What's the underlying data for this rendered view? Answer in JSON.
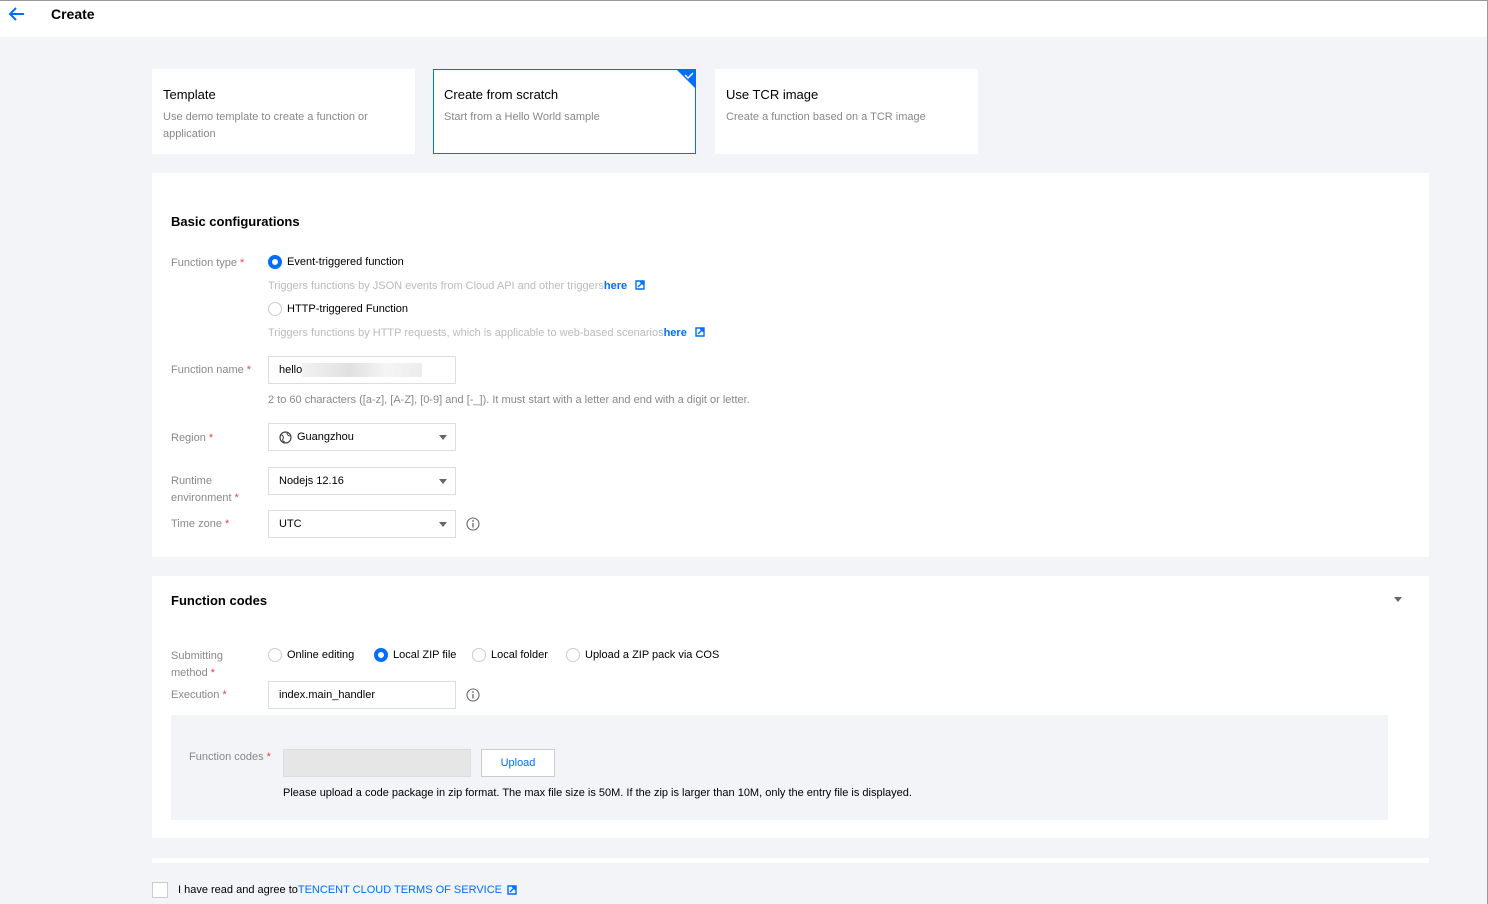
{
  "header": {
    "title": "Create"
  },
  "modes": [
    {
      "title": "Template",
      "desc": "Use demo template to create a function or application"
    },
    {
      "title": "Create from scratch",
      "desc": "Start from a Hello World sample"
    },
    {
      "title": "Use TCR image",
      "desc": "Create a function based on a TCR image"
    }
  ],
  "basic": {
    "title": "Basic configurations",
    "function_type_label": "Function type",
    "event_option": "Event-triggered function",
    "event_hint": "Triggers functions by JSON events from Cloud API and other triggers",
    "event_link": "here",
    "http_option": "HTTP-triggered Function",
    "http_hint": "Triggers functions by HTTP requests, which is applicable to web-based scenarios",
    "http_link": "here",
    "function_name_label": "Function name",
    "function_name_value": "hello",
    "function_name_help": "2 to 60 characters ([a-z], [A-Z], [0-9] and [-_]). It must start with a letter and end with a digit or letter.",
    "region_label": "Region",
    "region_value": "Guangzhou",
    "runtime_label_1": "Runtime",
    "runtime_label_2": "environment",
    "runtime_value": "Nodejs 12.16",
    "timezone_label": "Time zone",
    "timezone_value": "UTC"
  },
  "codes": {
    "title": "Function codes",
    "submit_label_1": "Submitting",
    "submit_label_2": "method",
    "methods": [
      "Online editing",
      "Local ZIP file",
      "Local folder",
      "Upload a ZIP pack via COS"
    ],
    "execution_label": "Execution",
    "execution_value": "index.main_handler",
    "function_codes_label": "Function codes",
    "upload_label": "Upload",
    "upload_note": "Please upload a code package in zip format. The max file size is 50M. If the zip is larger than 10M, only the entry file is displayed."
  },
  "agreement": {
    "text": "I have read and agree to",
    "link": "TENCENT CLOUD TERMS OF SERVICE"
  },
  "colors": {
    "accent": "#006eff",
    "required": "#e54545",
    "background": "#f3f4f7"
  }
}
